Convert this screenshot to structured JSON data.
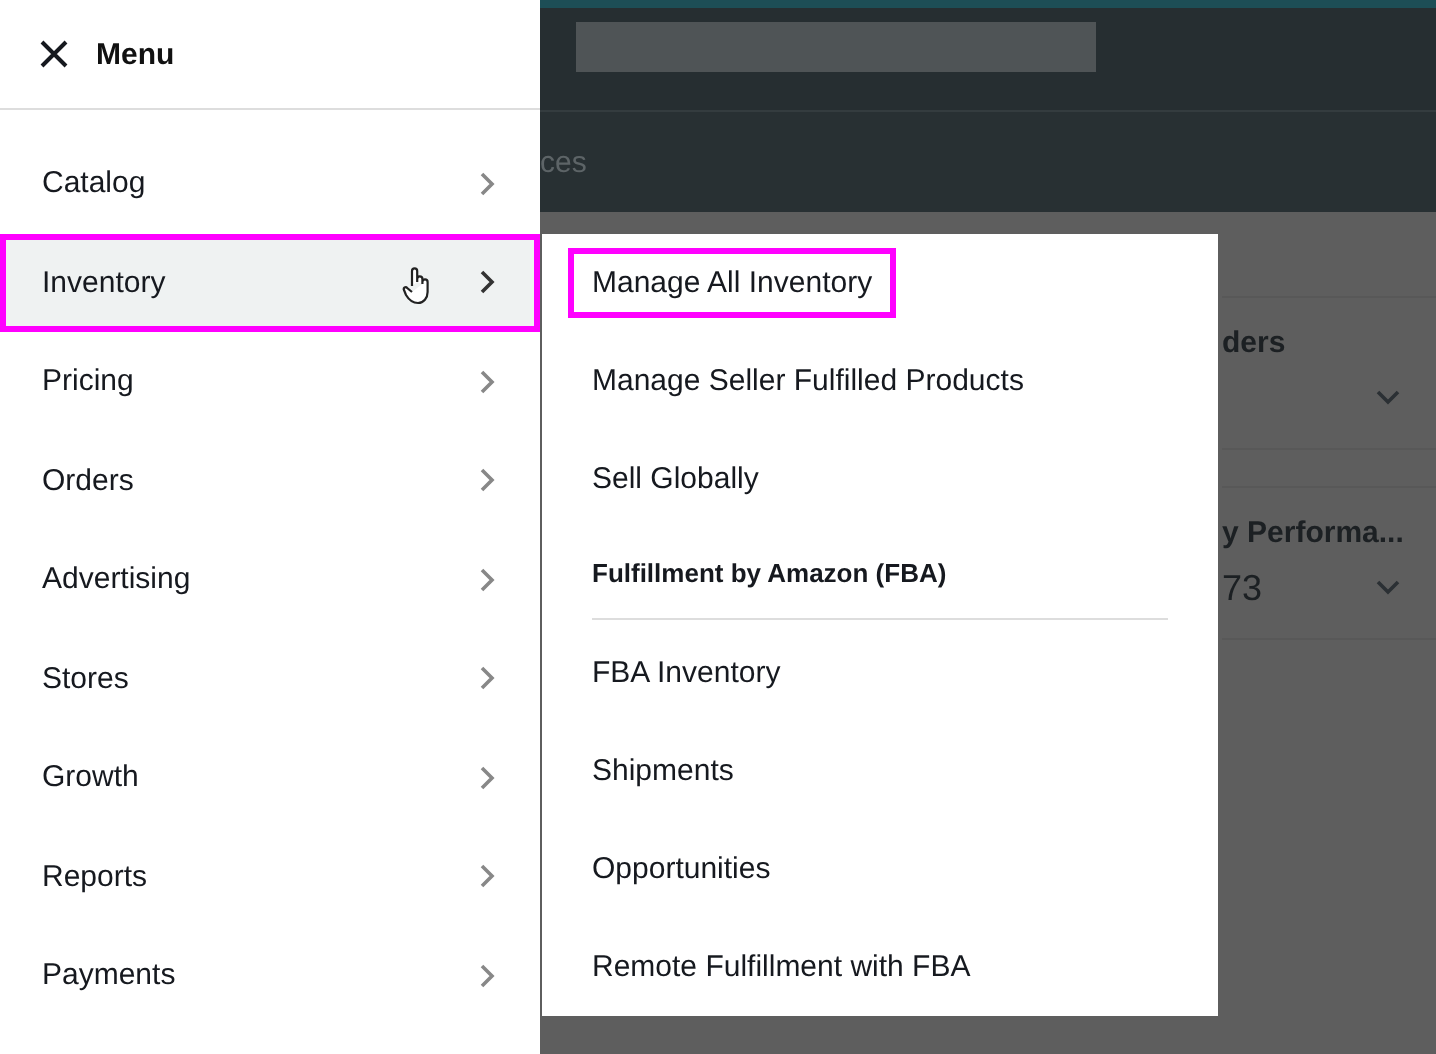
{
  "background": {
    "nav_text": "ces",
    "cards": [
      {
        "title": "ders",
        "expandable": true
      },
      {
        "title": "y Performa...",
        "value": "73",
        "expandable": true
      }
    ]
  },
  "menu": {
    "title": "Menu",
    "items": [
      {
        "label": "Catalog",
        "selected": false,
        "highlighted": false
      },
      {
        "label": "Inventory",
        "selected": true,
        "highlighted": true
      },
      {
        "label": "Pricing",
        "selected": false,
        "highlighted": false
      },
      {
        "label": "Orders",
        "selected": false,
        "highlighted": false
      },
      {
        "label": "Advertising",
        "selected": false,
        "highlighted": false
      },
      {
        "label": "Stores",
        "selected": false,
        "highlighted": false
      },
      {
        "label": "Growth",
        "selected": false,
        "highlighted": false
      },
      {
        "label": "Reports",
        "selected": false,
        "highlighted": false
      },
      {
        "label": "Payments",
        "selected": false,
        "highlighted": false
      }
    ]
  },
  "submenu": {
    "items": [
      {
        "kind": "link",
        "label": "Manage All Inventory",
        "highlighted": true
      },
      {
        "kind": "link",
        "label": "Manage Seller Fulfilled Products",
        "highlighted": false
      },
      {
        "kind": "link",
        "label": "Sell Globally",
        "highlighted": false
      },
      {
        "kind": "heading",
        "label": "Fulfillment by Amazon (FBA)",
        "highlighted": false
      },
      {
        "kind": "link",
        "label": "FBA Inventory",
        "highlighted": false
      },
      {
        "kind": "link",
        "label": "Shipments",
        "highlighted": false
      },
      {
        "kind": "link",
        "label": "Opportunities",
        "highlighted": false
      },
      {
        "kind": "link",
        "label": "Remote Fulfillment with FBA",
        "highlighted": false
      }
    ]
  }
}
